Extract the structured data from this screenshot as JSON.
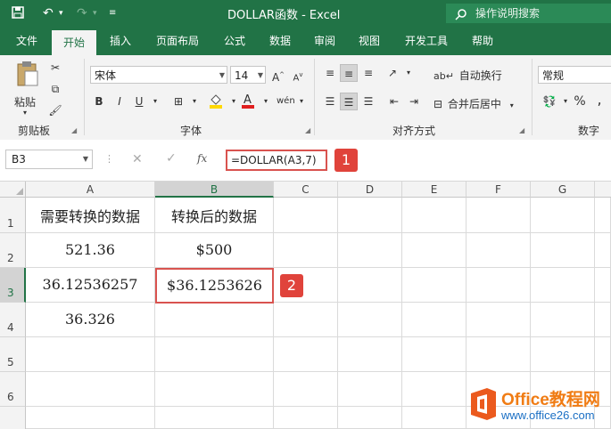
{
  "window": {
    "title": "DOLLAR函数  -  Excel",
    "search_placeholder": "操作说明搜索"
  },
  "ribbon_tabs": [
    "文件",
    "开始",
    "插入",
    "页面布局",
    "公式",
    "数据",
    "审阅",
    "视图",
    "开发工具",
    "帮助"
  ],
  "ribbon": {
    "paste_label": "粘贴",
    "clipboard_label": "剪贴板",
    "font_name": "宋体",
    "font_size": "14",
    "font_group_label": "字体",
    "bold": "B",
    "italic": "I",
    "underline": "U",
    "wrap_text": "自动换行",
    "merge_center": "合并后居中",
    "alignment_label": "对齐方式",
    "number_format": "常规",
    "number_label": "数字",
    "percent": "%",
    "comma": ","
  },
  "formula_bar": {
    "name_box": "B3",
    "fx": "fx",
    "formula": "=DOLLAR(A3,7)"
  },
  "callouts": [
    "1",
    "2"
  ],
  "columns": [
    "A",
    "B",
    "C",
    "D",
    "E",
    "F",
    "G"
  ],
  "rows": [
    "1",
    "2",
    "3",
    "4",
    "5",
    "6"
  ],
  "cells": {
    "A1": "需要转换的数据",
    "B1": "转换后的数据",
    "A2": "521.36",
    "B2": "$500",
    "A3": "36.12536257",
    "B3": "$36.1253626",
    "A4": "36.326"
  },
  "watermark": {
    "title": "Office教程网",
    "url": "www.office26.com"
  },
  "colors": {
    "excel_green": "#217346",
    "highlight_red": "#d9534f",
    "office_orange": "#f07c14"
  }
}
